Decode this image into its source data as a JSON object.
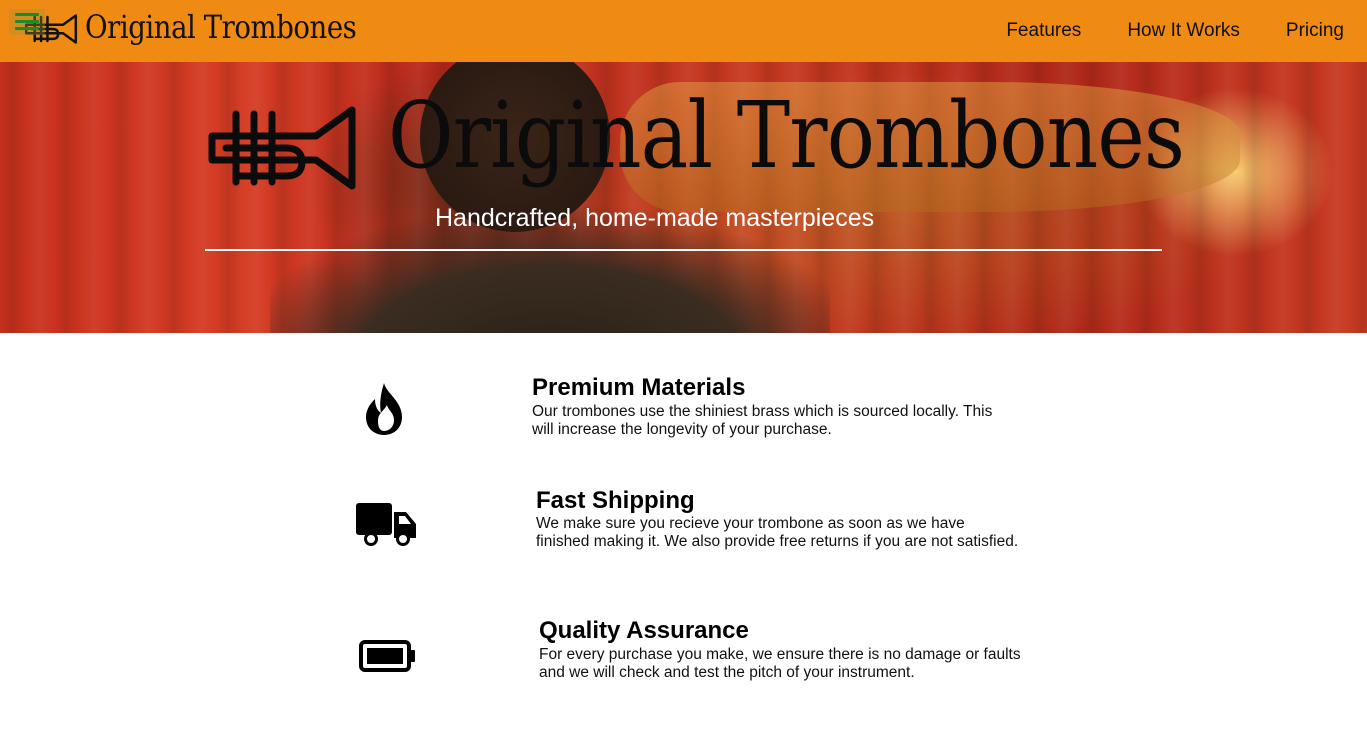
{
  "header": {
    "brand_name": "Original Trombones",
    "nav": [
      "Features",
      "How It Works",
      "Pricing"
    ],
    "bg_color": "#ef8a13",
    "menu_icon": "hamburger-menu-icon",
    "logo_icon": "trumpet-logo-icon"
  },
  "hero": {
    "title": "Original Trombones",
    "tagline": "Handcrafted, home-made masterpieces",
    "logo_icon": "trumpet-logo-icon"
  },
  "features": [
    {
      "icon": "flame-icon",
      "title": "Premium Materials",
      "description": "Our trombones use the shiniest brass which is sourced locally. This will increase the longevity of your purchase."
    },
    {
      "icon": "truck-icon",
      "title": "Fast Shipping",
      "description": "We make sure you recieve your trombone as soon as we have finished making it. We also provide free returns if you are not satisfied."
    },
    {
      "icon": "battery-full-icon",
      "title": "Quality Assurance",
      "description": "For every purchase you make, we ensure there is no damage or faults and we will check and test the pitch of your instrument."
    }
  ]
}
